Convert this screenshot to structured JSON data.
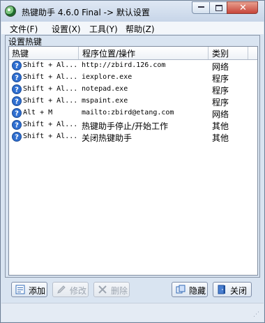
{
  "window": {
    "title": "热键助手 4.6.0 Final -> 默认设置",
    "app_icon": "green-globe-icon"
  },
  "menu": [
    {
      "label": "文件(F)"
    },
    {
      "label": "设置(X)"
    },
    {
      "label": "工具(Y)"
    },
    {
      "label": "帮助(Z)"
    }
  ],
  "group": {
    "label": "设置热键"
  },
  "table": {
    "columns": [
      "热键",
      "程序位置/操作",
      "类别"
    ],
    "rows": [
      {
        "hotkey": "Shift + Al...",
        "program": "http://zbird.126.com",
        "type": "网络",
        "icon": "help-circle-icon"
      },
      {
        "hotkey": "Shift + Al...",
        "program": "iexplore.exe",
        "type": "程序",
        "icon": "help-circle-icon"
      },
      {
        "hotkey": "Shift + Al...",
        "program": "notepad.exe",
        "type": "程序",
        "icon": "help-circle-icon"
      },
      {
        "hotkey": "Shift + Al...",
        "program": "mspaint.exe",
        "type": "程序",
        "icon": "help-circle-icon"
      },
      {
        "hotkey": "Alt + M",
        "program": "mailto:zbird@etang.com",
        "type": "网络",
        "icon": "help-circle-icon"
      },
      {
        "hotkey": "Shift + Al...",
        "program": "热键助手停止/开始工作",
        "type": "其他",
        "icon": "help-circle-icon"
      },
      {
        "hotkey": "Shift + Al...",
        "program": "关闭热键助手",
        "type": "其他",
        "icon": "help-circle-icon"
      }
    ]
  },
  "buttons": {
    "add": "添加",
    "edit": "修改",
    "delete": "删除",
    "hide": "隐藏",
    "close": "关闭"
  },
  "colors": {
    "accent": "#2f6fd1",
    "window_bg": "#d9e4f1",
    "disabled_text": "#9ea6b1"
  }
}
